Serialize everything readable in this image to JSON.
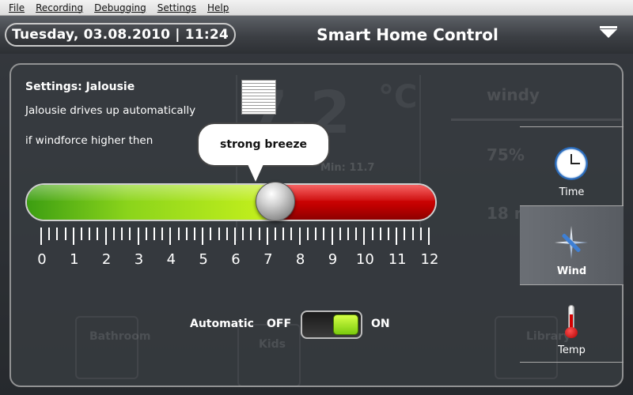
{
  "menubar": {
    "items": [
      "File",
      "Recording",
      "Debugging",
      "Settings",
      "Help"
    ]
  },
  "header": {
    "datetime": "Tuesday, 03.08.2010 | 11:24",
    "title": "Smart Home Control"
  },
  "background": {
    "temperature": "7,2",
    "unit": "°C",
    "min": "Min: 11.7",
    "wind_status": "windy",
    "humidity": "75%",
    "rain": "18 ml/m²",
    "rooms": [
      "Bathroom",
      "Kids",
      "Library"
    ]
  },
  "settings": {
    "title": "Settings: Jalousie",
    "line1": "Jalousie drives up automatically",
    "line2": "if windforce higher then"
  },
  "slider": {
    "tooltip": "strong breeze",
    "min": 0,
    "max": 12,
    "value": 7,
    "scale_labels": [
      "0",
      "1",
      "2",
      "3",
      "4",
      "5",
      "6",
      "7",
      "8",
      "9",
      "10",
      "11",
      "12"
    ]
  },
  "toggle": {
    "label": "Automatic",
    "off_label": "OFF",
    "on_label": "ON",
    "state": "on"
  },
  "side_tabs": [
    {
      "label": "Time",
      "icon": "clock-icon",
      "active": false
    },
    {
      "label": "Wind",
      "icon": "compass-icon",
      "active": true
    },
    {
      "label": "Temp",
      "icon": "thermometer-icon",
      "active": false
    }
  ],
  "colors": {
    "green_zone": "#8bd41b",
    "red_zone": "#c10000",
    "toggle_on": "#a5e41a"
  }
}
